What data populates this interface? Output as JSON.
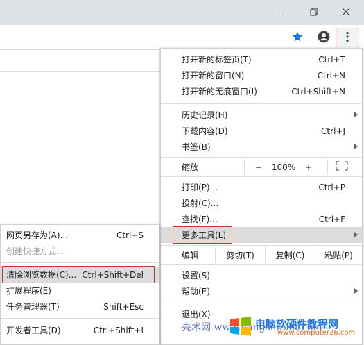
{
  "window_controls": {
    "minimize": "minimize-icon",
    "maximize": "restore-icon",
    "close": "close-icon"
  },
  "toolbar": {
    "bookmark_icon": "star-icon",
    "account_icon": "account-icon",
    "menu_icon": "vertical-dots-icon"
  },
  "main_menu": {
    "new_tab": {
      "label": "打开新的标签页(T)",
      "shortcut": "Ctrl+T"
    },
    "new_window": {
      "label": "打开新的窗口(N)",
      "shortcut": "Ctrl+N"
    },
    "new_incognito": {
      "label": "打开新的无痕窗口(I)",
      "shortcut": "Ctrl+Shift+N"
    },
    "history": {
      "label": "历史记录(H)"
    },
    "downloads": {
      "label": "下载内容(D)",
      "shortcut": "Ctrl+J"
    },
    "bookmarks": {
      "label": "书签(B)"
    },
    "zoom": {
      "label": "缩放",
      "minus": "−",
      "level": "100%",
      "plus": "+"
    },
    "print": {
      "label": "打印(P)...",
      "shortcut": "Ctrl+P"
    },
    "cast": {
      "label": "投射(C)..."
    },
    "find": {
      "label": "查找(F)...",
      "shortcut": "Ctrl+F"
    },
    "more_tools": {
      "label": "更多工具(L)"
    },
    "edit": {
      "label": "编辑",
      "cut": "剪切(T)",
      "copy": "复制(C)",
      "paste": "粘贴(P)"
    },
    "settings": {
      "label": "设置(S)"
    },
    "help": {
      "label": "帮助(E)"
    },
    "exit": {
      "label": "退出(X)"
    }
  },
  "sub_menu": {
    "save_page": {
      "label": "网页另存为(A)...",
      "shortcut": "Ctrl+S"
    },
    "create_shortcut": {
      "label": "创建快捷方式..."
    },
    "clear_data": {
      "label": "清除浏览数据(C)...",
      "shortcut": "Ctrl+Shift+Del"
    },
    "extensions": {
      "label": "扩展程序(E)"
    },
    "task_manager": {
      "label": "任务管理器(T)",
      "shortcut": "Shift+Esc"
    },
    "dev_tools": {
      "label": "开发者工具(D)",
      "shortcut": "Ctrl+Shift+I"
    }
  },
  "watermark": {
    "left_text": "亮术网 www.liangshunet.com",
    "brand": "电脑软硬件教程网",
    "url": "www.computer26.com"
  },
  "colors": {
    "highlight_border": "#c0392b",
    "accent_blue": "#1a73e8",
    "titlebar_bg": "#dee1e6"
  }
}
